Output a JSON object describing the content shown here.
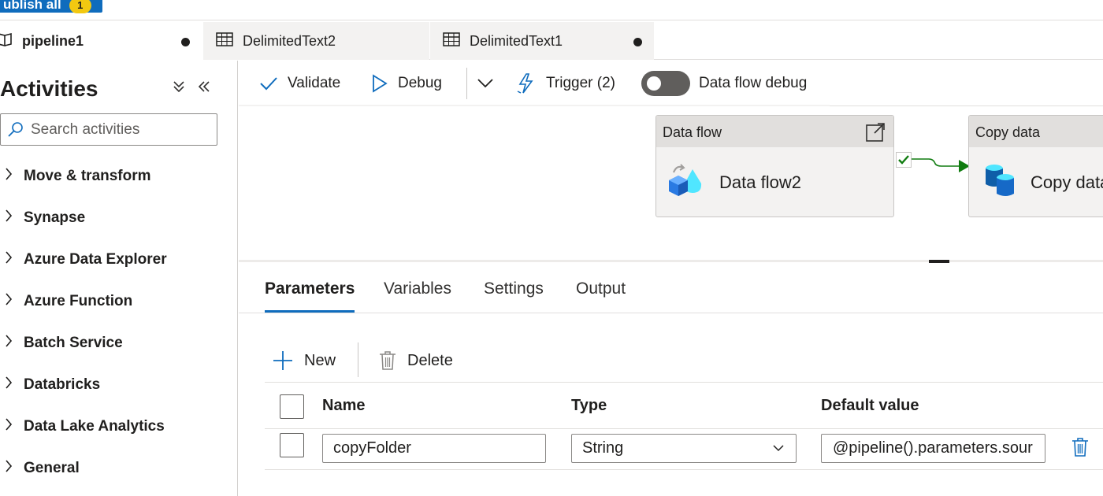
{
  "publish": {
    "label": "ublish all",
    "badge": "1"
  },
  "tabs": [
    {
      "label": "pipeline1",
      "dirty": true
    },
    {
      "label": "DelimitedText2",
      "dirty": false
    },
    {
      "label": "DelimitedText1",
      "dirty": true
    }
  ],
  "activities": {
    "title": "Activities",
    "search_placeholder": "Search activities",
    "categories": [
      "Move & transform",
      "Synapse",
      "Azure Data Explorer",
      "Azure Function",
      "Batch Service",
      "Databricks",
      "Data Lake Analytics",
      "General"
    ]
  },
  "toolbar": {
    "validate": "Validate",
    "debug": "Debug",
    "trigger": "Trigger (2)",
    "dataflow_debug": "Data flow debug",
    "dataflow_debug_on": false
  },
  "canvas": {
    "nodes": [
      {
        "type": "Data flow",
        "name": "Data flow2"
      },
      {
        "type": "Copy data",
        "name": "Copy data"
      }
    ]
  },
  "bottom": {
    "tabs": [
      "Parameters",
      "Variables",
      "Settings",
      "Output"
    ],
    "active_tab": "Parameters",
    "new_label": "New",
    "delete_label": "Delete",
    "columns": [
      "Name",
      "Type",
      "Default value"
    ],
    "rows": [
      {
        "name": "copyFolder",
        "type": "String",
        "default": "@pipeline().parameters.sour"
      }
    ]
  },
  "colors": {
    "accent": "#0f6cbd",
    "success": "#107c10"
  }
}
